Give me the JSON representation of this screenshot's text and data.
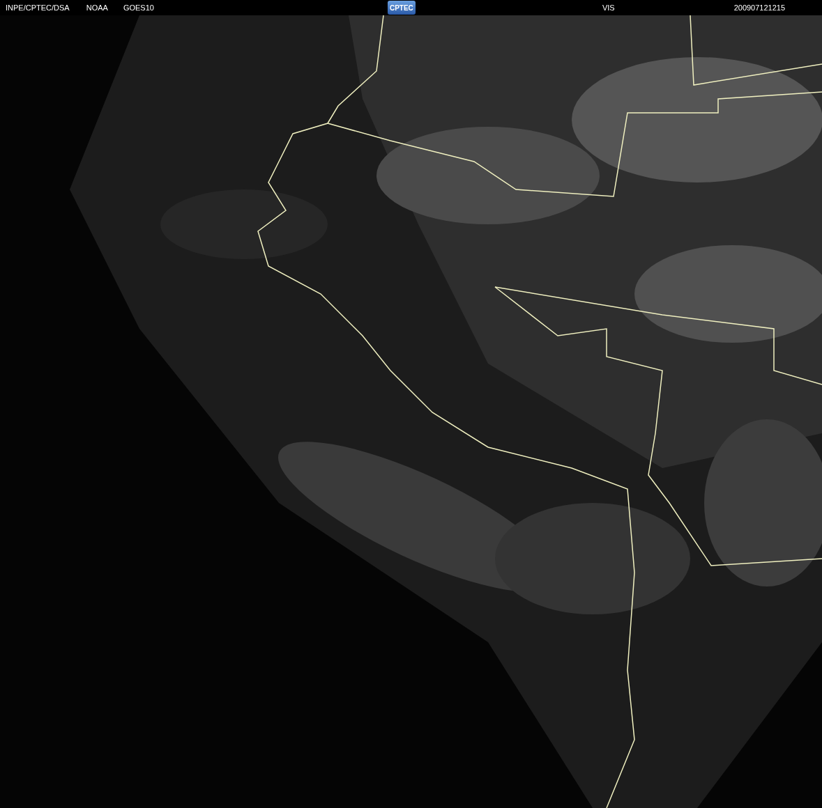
{
  "header": {
    "source": "INPE/CPTEC/DSA",
    "agency": "NOAA",
    "satellite": "GOES10",
    "logo": "CPTEC",
    "channel": "VIS",
    "timestamp": "200907121215"
  }
}
